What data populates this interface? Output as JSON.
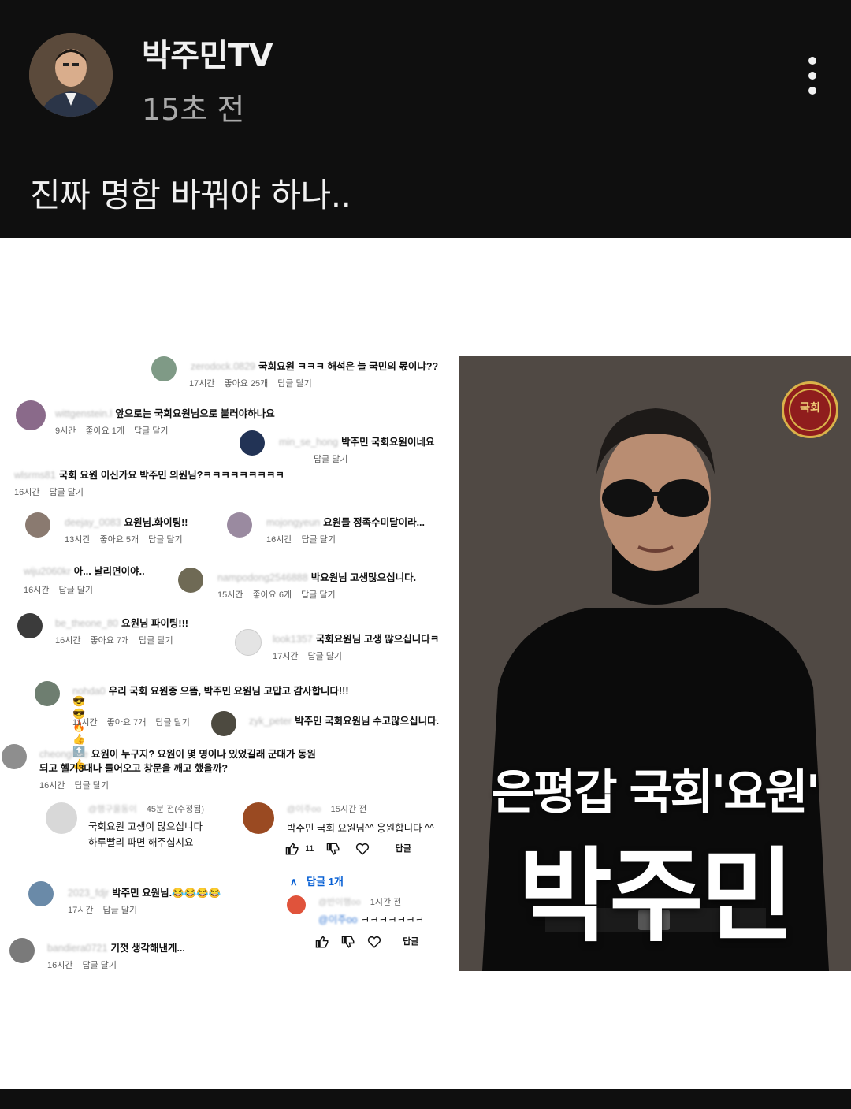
{
  "post": {
    "channel_name": "박주민TV",
    "time": "15초 전",
    "text": "진짜 명함 바꿔야 하나.."
  },
  "image": {
    "title_line1": "은평갑 국회'요원'",
    "title_line2": "박주민",
    "seal_label": "국회",
    "comments": [
      {
        "user": "zerodock.0829",
        "text": "국회요원 ㅋㅋㅋ 해석은 늘 국민의 몫이냐??",
        "time": "17시간",
        "likes": "좋아요 25개",
        "reply": "답글 달기"
      },
      {
        "user": "wittgenstein.l",
        "text": "앞으로는 국회요원님으로 불러야하나요",
        "time": "9시간",
        "likes": "좋아요 1개",
        "reply": "답글 달기"
      },
      {
        "user": "min_se_hong",
        "text": "박주민 국회요원이네요",
        "reply": "답글 달기"
      },
      {
        "user": "wlsrms81",
        "text": "국회 요원 이신가요 박주민 의원님?ㅋㅋㅋㅋㅋㅋㅋㅋㅋ",
        "time": "16시간",
        "reply": "답글 달기"
      },
      {
        "user": "deejay_0083",
        "text": "요원님.화이팅!!",
        "time": "13시간",
        "likes": "좋아요 5개",
        "reply": "답글 달기"
      },
      {
        "user": "mojongyeun",
        "text": "요원들 정족수미달이라...",
        "time": "16시간",
        "reply": "답글 달기"
      },
      {
        "user": "wiju2060kr",
        "text": "아... 날리면이야..",
        "time": "16시간",
        "reply": "답글 달기"
      },
      {
        "user": "nampodong2546888",
        "text": "박요원님 고생많으십니다.",
        "time": "15시간",
        "likes": "좋아요 6개",
        "reply": "답글 달기"
      },
      {
        "user": "be_theone_80",
        "text": "요원님 파이팅!!!",
        "time": "16시간",
        "likes": "좋아요 7개",
        "reply": "답글 달기"
      },
      {
        "user": "look1357",
        "text": "국회요원님 고생 많으십니다ㅋ",
        "time": "17시간",
        "reply": "답글 달기"
      },
      {
        "user": "nohda0",
        "text": "우리 국회 요원중 으뜸, 박주민 요원님 고맙고 감사합니다!!!",
        "emoji": "😎😎🔥👍🔝👍",
        "time": "11시간",
        "likes": "좋아요 7개",
        "reply": "답글 달기"
      },
      {
        "user": "zyk_peter",
        "text": "박주민 국회요원님 수고많으십니다."
      },
      {
        "user": "cheonghae",
        "text": "요원이 누구지? 요원이 몇 명이나 있었길래 군대가 동원",
        "text2": "되고 헬기3대나 들어오고 창문을 깨고 했을까?",
        "time": "16시간",
        "reply": "답글 달기"
      },
      {
        "user": "@행구울동이",
        "time_label": "45분 전(수정됨)",
        "text": "국회요원 고생이 많으십니다",
        "text2": "하루빨리 파면 해주십시요"
      },
      {
        "user": "@이주oo",
        "time_label": "15시간 전",
        "text": "박주민 국회 요원님^^ 응원합니다 ^^",
        "like_count": "11",
        "reply": "답글"
      },
      {
        "replies_label": "답글 1개"
      },
      {
        "user": "@반이행oo",
        "time_label": "1시간 전",
        "mention": "@이주oo",
        "text": "ㅋㅋㅋㅋㅋㅋㅋ",
        "reply": "답글"
      },
      {
        "user": "2023_fdjr",
        "text": "박주민 요원님.😂😂😂😂",
        "time": "17시간",
        "reply": "답글 달기"
      },
      {
        "user": "bandiera0721",
        "text": "기껏 생각해낸게...",
        "time": "16시간",
        "reply": "답글 달기"
      }
    ]
  },
  "colors": {
    "background": "#0f0f0f",
    "text_primary": "#f1f1f1",
    "text_secondary": "#aaaaaa",
    "seal_red": "#8f1d1d",
    "reply_blue": "#065fd4"
  }
}
